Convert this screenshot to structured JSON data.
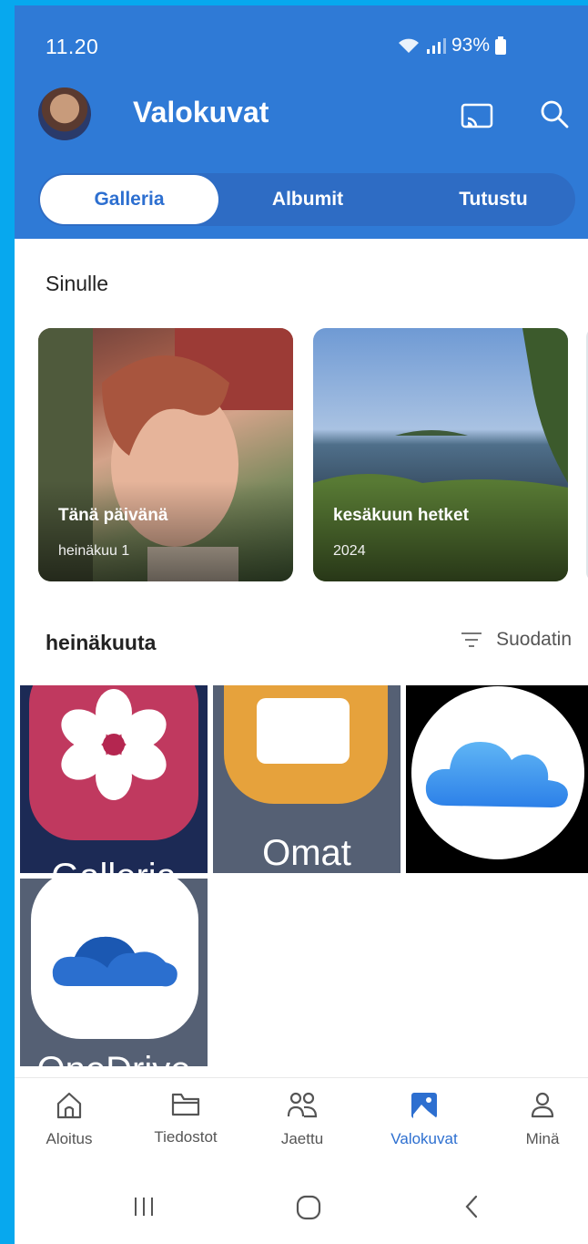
{
  "status": {
    "time": "11.20",
    "battery": "93%"
  },
  "header": {
    "title": "Valokuvat"
  },
  "tabs": [
    {
      "label": "Galleria",
      "active": true
    },
    {
      "label": "Albumit",
      "active": false
    },
    {
      "label": "Tutustu",
      "active": false
    }
  ],
  "for_you": {
    "title": "Sinulle",
    "cards": [
      {
        "title": "Tänä päivänä",
        "subtitle": "heinäkuu 1"
      },
      {
        "title": "kesäkuun hetket",
        "subtitle": "2024"
      }
    ]
  },
  "month": {
    "title": "heinäkuuta",
    "filter_label": "Suodatin"
  },
  "tiles": [
    {
      "label": "Galleria",
      "icon": "gallery-flower-icon"
    },
    {
      "label": "Omat",
      "icon": "my-files-folder-icon"
    },
    {
      "label": "",
      "icon": "icloud-icon"
    },
    {
      "label": "OneDrive",
      "icon": "onedrive-cloud-icon"
    }
  ],
  "bottom_nav": [
    {
      "label": "Aloitus",
      "icon": "home-icon",
      "active": false
    },
    {
      "label": "Tiedostot",
      "icon": "folder-icon",
      "active": false
    },
    {
      "label": "Jaettu",
      "icon": "people-icon",
      "active": false
    },
    {
      "label": "Valokuvat",
      "icon": "photos-icon",
      "active": true
    },
    {
      "label": "Minä",
      "icon": "person-icon",
      "active": false
    }
  ],
  "colors": {
    "accent": "#2d6fd0",
    "header": "#2f7ad6",
    "frame": "#07a8ee"
  }
}
